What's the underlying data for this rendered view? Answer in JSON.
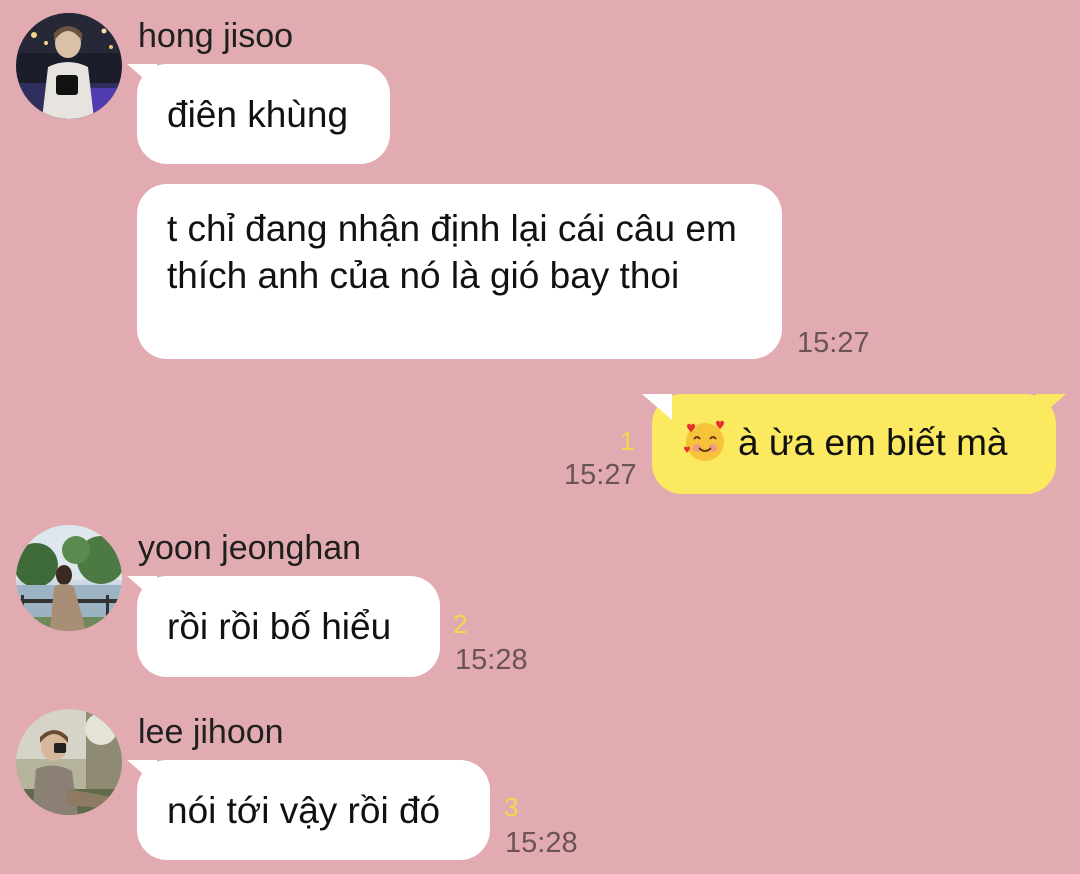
{
  "messages": [
    {
      "sender": "hong jisoo",
      "avatar_icon": "avatar-hong-jisoo",
      "bubbles": [
        {
          "text": "điên khùng"
        },
        {
          "text": "t chỉ đang nhận định lại cái câu em thích anh của nó là gió bay thoi",
          "time": "15:27"
        }
      ]
    },
    {
      "sender": "me",
      "bubbles": [
        {
          "emoji": "smiling-face-with-hearts",
          "text": "à ừa em biết mà",
          "time": "15:27",
          "unread": "1"
        }
      ]
    },
    {
      "sender": "yoon jeonghan",
      "avatar_icon": "avatar-yoon-jeonghan",
      "bubbles": [
        {
          "text": "rồi rồi bố hiểu",
          "time": "15:28",
          "unread": "2"
        }
      ]
    },
    {
      "sender": "lee jihoon",
      "avatar_icon": "avatar-lee-jihoon",
      "bubbles": [
        {
          "text": "nói tới vậy rồi đó",
          "time": "15:28",
          "unread": "3"
        }
      ]
    }
  ],
  "colors": {
    "background": "#e2aab1",
    "incoming_bubble": "#ffffff",
    "outgoing_bubble": "#fbe960",
    "unread_count": "#f1db4a",
    "timestamp": "#6b5456"
  }
}
